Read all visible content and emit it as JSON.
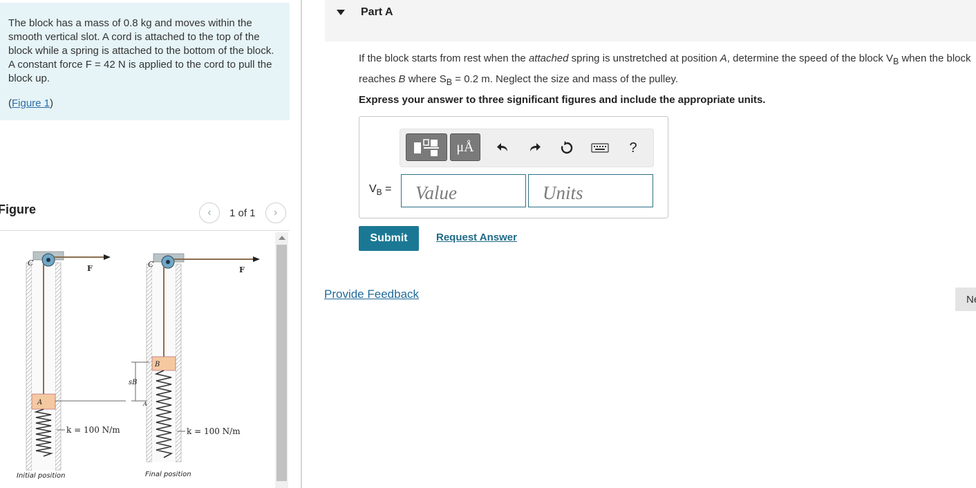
{
  "problem": {
    "intro_text": "The block has a mass of 0.8 kg and moves within the smooth vertical slot.  A cord is attached to the top of the block while a spring is attached to the bottom of the block.  A constant force F = 42 N is applied to the cord to pull the block up.",
    "figure_link_open": "(",
    "figure_link": "Figure 1",
    "figure_link_close": ")"
  },
  "figure_panel": {
    "heading": "Figure",
    "pager_text": "1 of 1",
    "prev_icon": "chevron-left-icon",
    "next_icon": "chevron-right-icon",
    "labels": {
      "c_left": "C",
      "f_left": "F",
      "a_left": "A",
      "k_left": "k = 100 N/m",
      "caption_left": "Initial position",
      "c_right": "C",
      "f_right": "F",
      "b_right": "B",
      "sb": "sB",
      "a_marker": "A",
      "k_right": "k = 100 N/m",
      "caption_right": "Final position"
    }
  },
  "part": {
    "title": "Part A",
    "question_line1_a": "If the block starts from rest when the ",
    "question_line1_em": "attached",
    "question_line1_b": " spring is unstretched at position ",
    "question_line1_A": "A",
    "question_line1_c": ", determine the speed of the block V",
    "question_line1_sub": "B",
    "question_line1_d": " when the block",
    "question_line2_a": "reaches ",
    "question_line2_B": "B",
    "question_line2_b": " where S",
    "question_line2_sub": "B",
    "question_line2_c": " = 0.2 m.  Neglect the size and mass of the pulley.",
    "instruction": "Express your answer to three significant figures and include the appropriate units."
  },
  "answer": {
    "variable": "V",
    "variable_sub": "B",
    "equals": " =",
    "value_placeholder": "Value",
    "units_placeholder": "Units",
    "toolbar": {
      "templates_icon": "templates-icon",
      "symbols_label": "μÅ",
      "undo_icon": "undo-icon",
      "redo_icon": "redo-icon",
      "reset_icon": "reset-icon",
      "keyboard_icon": "keyboard-icon",
      "help_label": "?"
    }
  },
  "actions": {
    "submit": "Submit",
    "request_answer": "Request Answer",
    "feedback": "Provide Feedback",
    "next": "Next"
  },
  "colors": {
    "intro_bg": "#e6f4f7",
    "submit_bg": "#1b7895",
    "link": "#1f6a86",
    "input_border": "#2e6f86"
  }
}
